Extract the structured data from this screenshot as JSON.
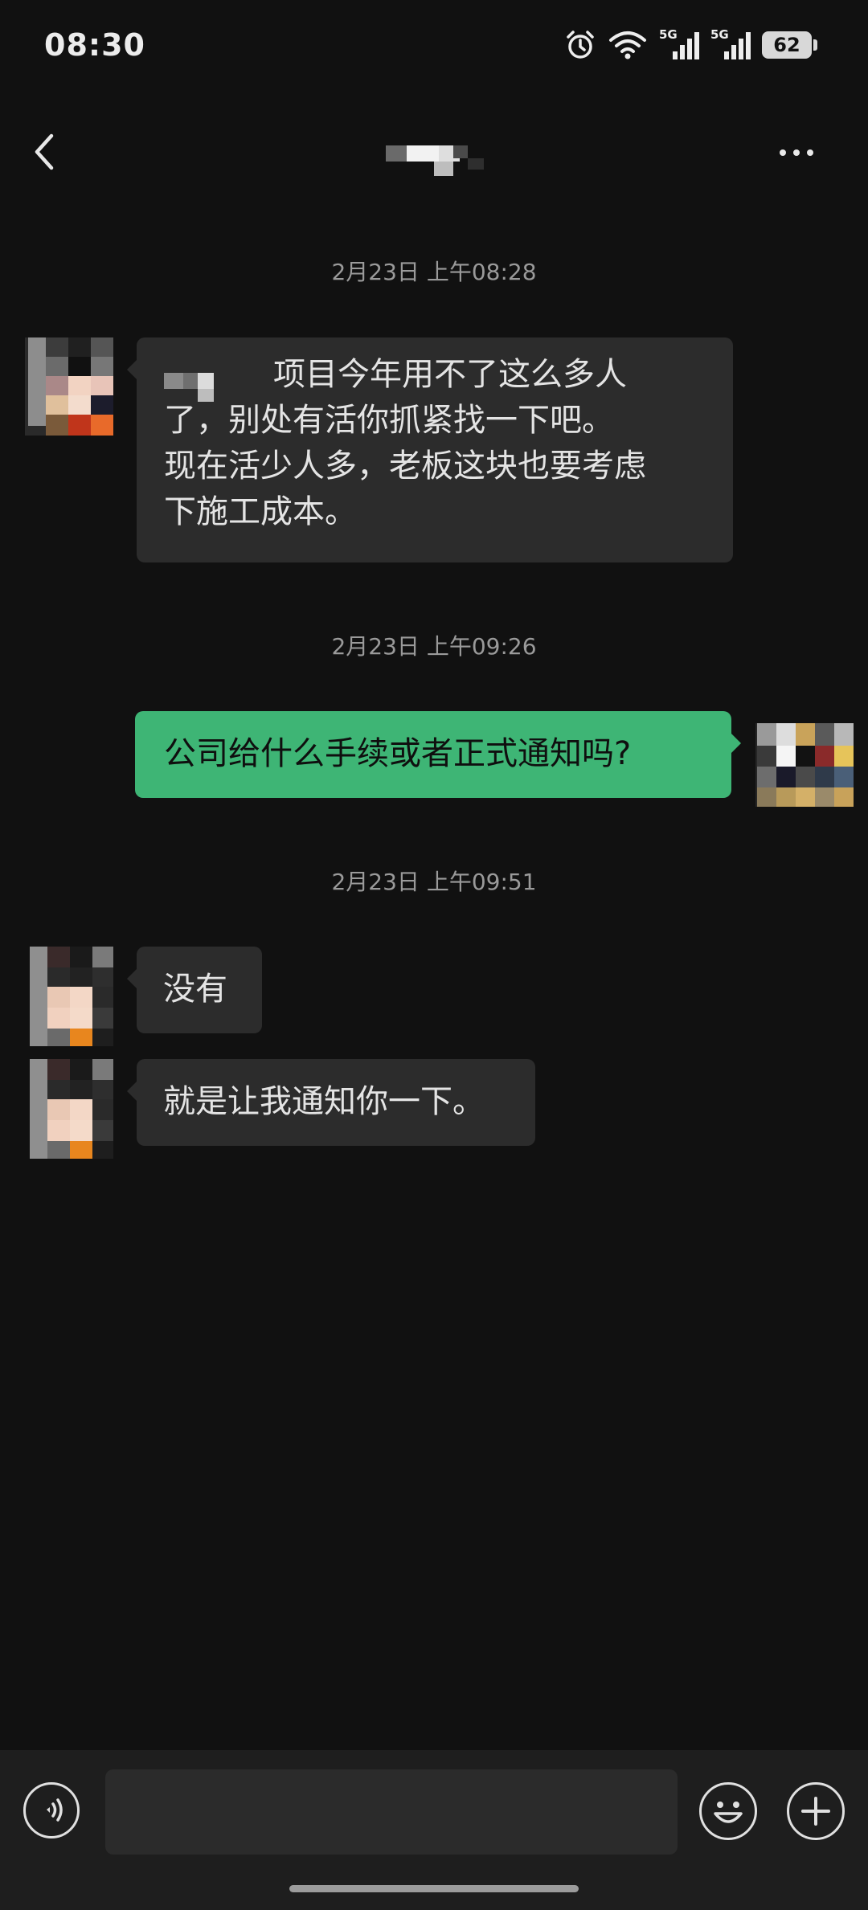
{
  "status_bar": {
    "time": "08:30",
    "icons": [
      "alarm-icon",
      "wifi-icon",
      "5g-signal-icon",
      "5g-signal-icon",
      "battery-icon"
    ],
    "signal_label_1": "5G",
    "signal_label_2": "5G",
    "battery_level": "62"
  },
  "header": {
    "contact_name": "",
    "back_icon": "chevron-left-icon",
    "more_icon": "ellipsis-icon"
  },
  "messages": [
    {
      "type": "timestamp",
      "text": "2月23日 上午08:28"
    },
    {
      "type": "incoming",
      "lines": [
        "项目今年用不了这么多人",
        "了，别处有活你抓紧找一下吧。",
        "现在活少人多，老板这块也要考虑",
        "下施工成本。"
      ]
    },
    {
      "type": "timestamp",
      "text": "2月23日 上午09:26"
    },
    {
      "type": "outgoing",
      "text": "公司给什么手续或者正式通知吗?"
    },
    {
      "type": "timestamp",
      "text": "2月23日 上午09:51"
    },
    {
      "type": "incoming",
      "text": "没有"
    },
    {
      "type": "incoming",
      "text": "就是让我通知你一下。"
    }
  ],
  "input_bar": {
    "voice_icon": "voice-icon",
    "input_value": "",
    "emoji_icon": "emoji-icon",
    "add_icon": "plus-icon"
  },
  "colors": {
    "background": "#111111",
    "incoming_bubble": "#2c2c2c",
    "outgoing_bubble": "#3eb575",
    "timestamp_text": "#9a9a9a"
  }
}
